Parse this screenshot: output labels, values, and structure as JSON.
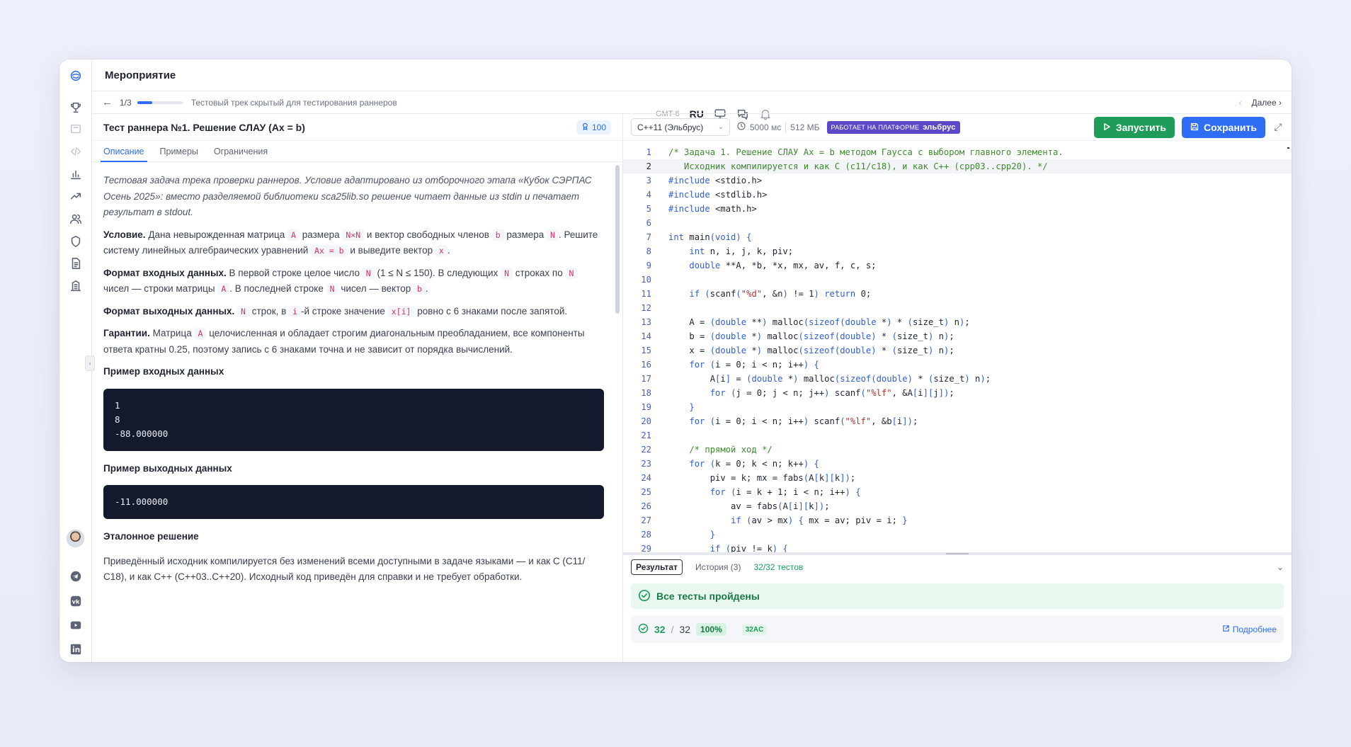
{
  "header": {
    "title": "Мероприятие",
    "timezone": "GMT-6",
    "language": "RU"
  },
  "subbar": {
    "counter": "1/3",
    "progress": 0.33,
    "track_name": "Тестовый трек скрытый для тестирования раннеров",
    "next_label": "Далее"
  },
  "task": {
    "title": "Тест раннера №1. Решение СЛАУ (Ax = b)",
    "score": "100",
    "tabs": [
      "Описание",
      "Примеры",
      "Ограничения"
    ],
    "intro": "Тестовая задача трека проверки раннеров. Условие адаптировано из отборочного этапа «Кубок СЭРПАС Осень 2025»: вместо разделяемой библиотеки sca25lib.so решение читает данные из stdin и печатает результат в stdout.",
    "condition": {
      "label": "Условие.",
      "t1": "Дана невырожденная матрица",
      "c1": "A",
      "t2": "размера",
      "c2": "N×N",
      "t3": "и вектор свободных членов",
      "c3": "b",
      "t4": "размера",
      "c4": "N",
      "t5": ". Решите систему линейных алгебраических уравнений",
      "c5": "Ax = b",
      "t6": "и выведите вектор",
      "c6": "x",
      "t7": "."
    },
    "input_format": {
      "label": "Формат входных данных.",
      "t1": "В первой строке целое число",
      "c1": "N",
      "t2": "(1 ≤ N ≤ 150). В следующих",
      "c2": "N",
      "t3": "строках по",
      "c3": "N",
      "t4": "чисел — строки матрицы",
      "c4": "A",
      "t5": ". В последней строке",
      "c5": "N",
      "t6": "чисел — вектор",
      "c6": "b",
      "t7": "."
    },
    "output_format": {
      "label": "Формат выходных данных.",
      "c1": "N",
      "t1": "строк, в",
      "c2": "i",
      "t2": "-й строке значение",
      "c3": "x[i]",
      "t3": "ровно с 6 знаками после запятой."
    },
    "guarantees": {
      "label": "Гарантии.",
      "t1": "Матрица",
      "c1": "A",
      "t2": "целочисленная и обладает строгим диагональным преобладанием, все компоненты ответа кратны 0.25, поэтому запись с 6 знаками точна и не зависит от порядка вычислений."
    },
    "example_input_title": "Пример входных данных",
    "example_input": "1\n8\n-88.000000",
    "example_output_title": "Пример выходных данных",
    "example_output": "-11.000000",
    "reference_title": "Эталонное решение",
    "reference_text": "Приведённый исходник компилируется без изменений всеми доступными в задаче языками — и как С (С11/С18), и как С++ (С++03..С++20). Исходный код приведён для справки и не требует обработки."
  },
  "editor": {
    "language": "C++11 (Эльбрус)",
    "time_limit": "5000 мс",
    "memory_limit": "512 МБ",
    "platform_label": "РАБОТАЕТ НА ПЛАТФОРМЕ",
    "platform_brand": "эльбрус",
    "run_label": "Запустить",
    "save_label": "Сохранить",
    "current_line": 2,
    "lines": [
      "/* Задача 1. Решение СЛАУ Ax = b методом Гаусса с выбором главного элемента.",
      "   Исходник компилируется и как C (c11/c18), и как C++ (cpp03..cpp20). */",
      "#include <stdio.h>",
      "#include <stdlib.h>",
      "#include <math.h>",
      "",
      "int main(void) {",
      "    int n, i, j, k, piv;",
      "    double **A, *b, *x, mx, av, f, c, s;",
      "",
      "    if (scanf(\"%d\", &n) != 1) return 0;",
      "",
      "    A = (double **) malloc(sizeof(double *) * (size_t) n);",
      "    b = (double *) malloc(sizeof(double) * (size_t) n);",
      "    x = (double *) malloc(sizeof(double) * (size_t) n);",
      "    for (i = 0; i < n; i++) {",
      "        A[i] = (double *) malloc(sizeof(double) * (size_t) n);",
      "        for (j = 0; j < n; j++) scanf(\"%lf\", &A[i][j]);",
      "    }",
      "    for (i = 0; i < n; i++) scanf(\"%lf\", &b[i]);",
      "",
      "    /* прямой ход */",
      "    for (k = 0; k < n; k++) {",
      "        piv = k; mx = fabs(A[k][k]);",
      "        for (i = k + 1; i < n; i++) {",
      "            av = fabs(A[i][k]);",
      "            if (av > mx) { mx = av; piv = i; }",
      "        }",
      "        if (piv != k) {"
    ]
  },
  "result": {
    "tabs": [
      "Результат",
      "История (3)",
      "32/32 тестов"
    ],
    "status": "Все тесты пройдены",
    "passed": "32",
    "total": "32",
    "percent": "100%",
    "verdict": "32AC",
    "details_label": "Подробнее"
  },
  "colors": {
    "accent": "#2f6df5",
    "success": "#1f9c5a",
    "platform": "#5b49c9",
    "code_bg": "#141a2b"
  }
}
